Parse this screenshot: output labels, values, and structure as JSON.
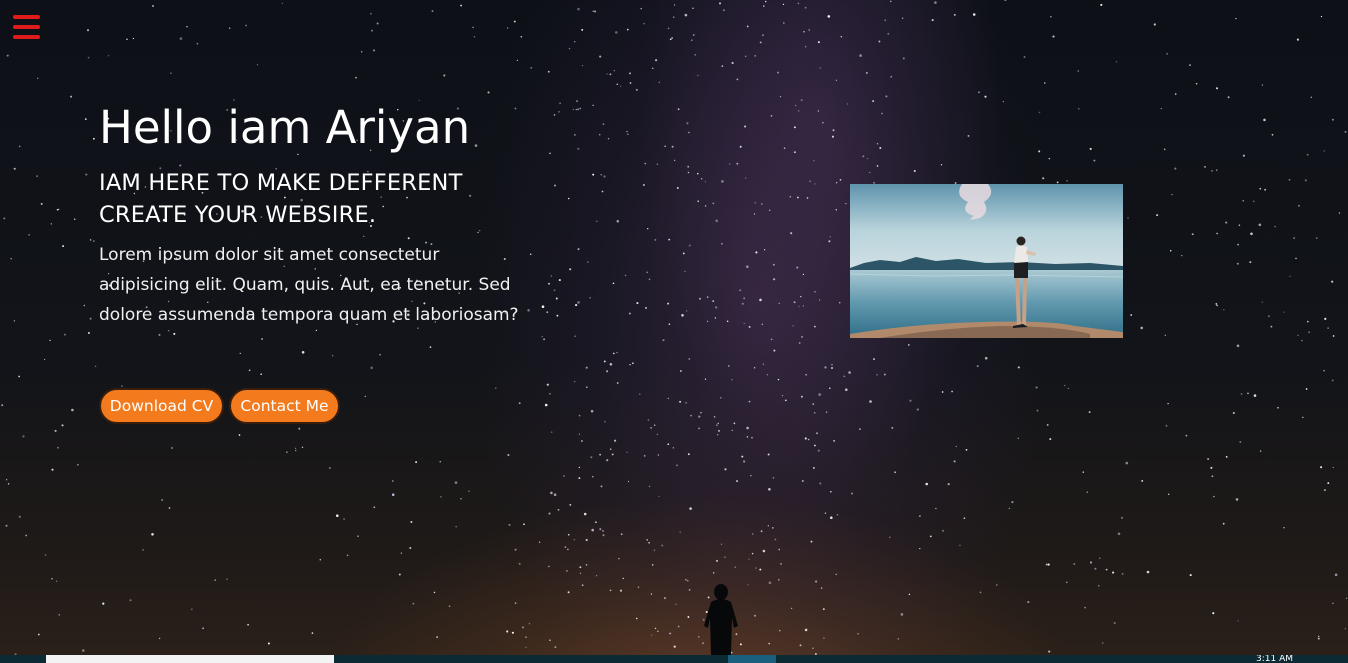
{
  "hero": {
    "title": "Hello iam Ariyan",
    "subtitle_line1": "IAM HERE TO MAKE DEFFERENT",
    "subtitle_line2": "CREATE YOUR WEBSIRE.",
    "description": "Lorem ipsum dolor sit amet consectetur adipisicing elit. Quam, quis. Aut, ea tenetur. Sed dolore assumenda tempora quam et laboriosam?",
    "buttons": {
      "download_cv": "Download CV",
      "contact_me": "Contact Me"
    }
  },
  "icons": {
    "menu": "hamburger-menu-icon"
  },
  "colors": {
    "menu_icon": "#e01b1b",
    "button_bg": "#f47a1e",
    "button_border": "#3a1e0c",
    "text": "#ffffff",
    "taskbar": "#0b2a33"
  },
  "taskbar": {
    "clock": "3:11 AM"
  }
}
